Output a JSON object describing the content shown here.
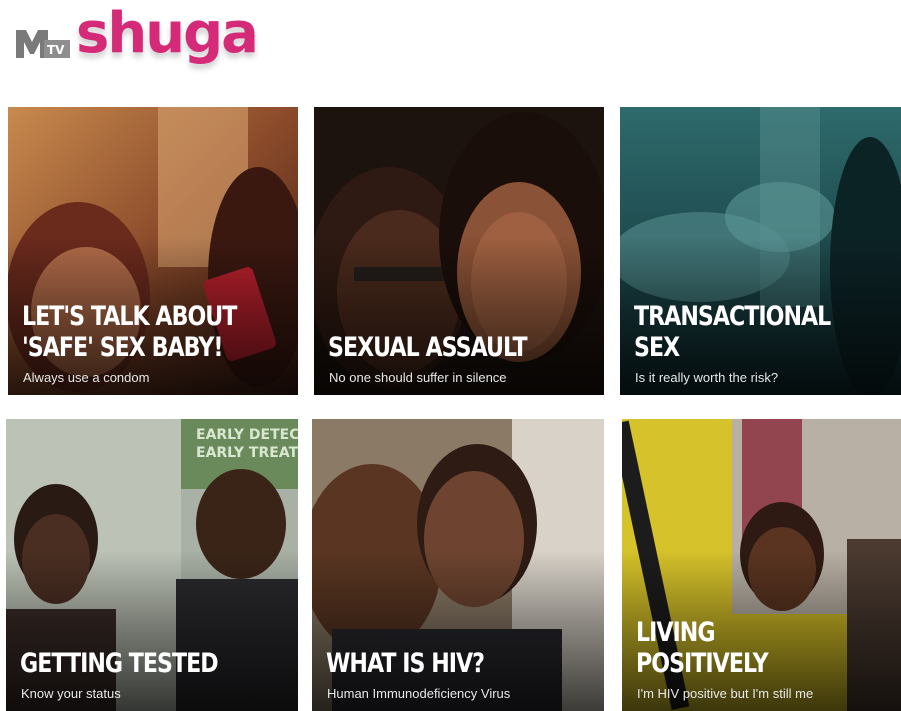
{
  "header": {
    "logo_icon": "mtv-logo-icon",
    "logo_text": "MTV",
    "brand_name": "shuga",
    "brand_color": "#d42a78"
  },
  "tiles": [
    {
      "title": "LET'S TALK ABOUT\n'SAFE' SEX BABY!",
      "subtitle": "Always use a condom"
    },
    {
      "title": "SEXUAL ASSAULT",
      "subtitle": "No one should suffer in silence"
    },
    {
      "title": "TRANSACTIONAL SEX",
      "subtitle": "Is it really worth the risk?"
    },
    {
      "title": "GETTING TESTED",
      "subtitle": "Know your status"
    },
    {
      "title": "WHAT IS HIV?",
      "subtitle": "Human Immunodeficiency Virus"
    },
    {
      "title": "LIVING POSITIVELY",
      "subtitle": "I'm HIV positive but I'm still me"
    }
  ],
  "photo_text": {
    "poster_line_1": "EARLY DETEC",
    "poster_line_2": "EARLY TREAT"
  }
}
